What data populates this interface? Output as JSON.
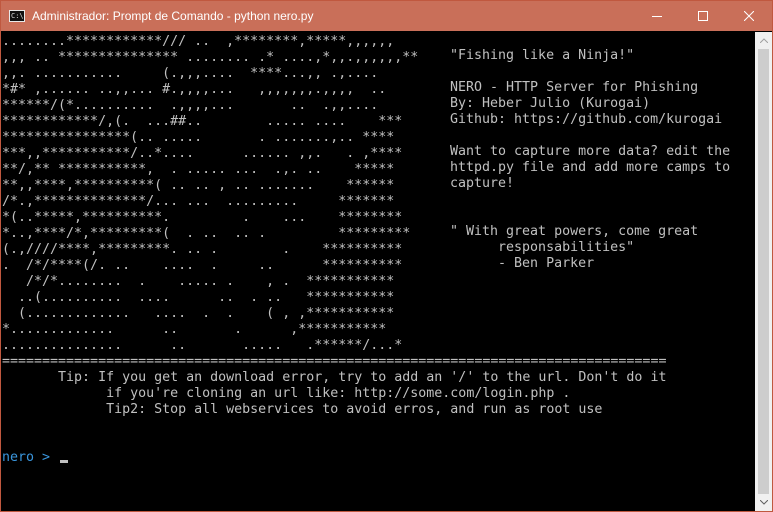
{
  "window": {
    "title": "Administrador: Prompt de Comando - python  nero.py",
    "icon_label": "C:\\"
  },
  "console": {
    "ascii_art": "........************/// ..  ,********,*****,,,,,,\n,,, .. *************** ........ .* ....,*,,.,,,,,,**\n,,. ...........     (.,,,....  ****...,, .,....\n*#* ,...... ..,,... #.,,,,...   ,,,,,,,.,,,,  ..\n******/(*..........  .,,,,...       ..  .,,....\n************/,(.  ...##..        ..... ....    ***\n****************(.. .....       . .......,.. ****\n***,,***********/..*....      ...... ,,.   . ,****\n**/,** ***********,  . ..... ...  .,. ..    *****\n**,,****,**********( .. .. , .. .......    ******\n/*.,**************/... ...  .........     *******\n*(..*****,**********.         .    ...    ********\n*..,****/*,*********(  . ..  .. .         *********\n(.,////****,*********. .. .        .    **********\n.  /*/****(/. ..    ....  .     ..      **********\n   /*/*........  .    ..... .    , .  ***********\n  ..(..........  ....      ..  . ..   ***********\n  (.............   ....  .  .    ( , ,***********\n*.............      ..       .      ,***********\n...............      ..       .....   .******/...*",
    "info_text": "\"Fishing like a Ninja!\"\n\nNERO - HTTP Server for Phishing\nBy: Heber Julio (Kurogai)\nGithub: https://github.com/kurogai\n\nWant to capture more data? edit the\nhttpd.py file and add more camps to\ncapture!\n\n\n\" With great powers, come great\n      responsabilities\"\n      - Ben Parker",
    "separator": "===============================================================================================",
    "tips_text": "       Tip: If you get an download error, try to add an '/' to the url. Don't do it\n             if you're cloning an url like: http://some.com/login.php .\n             Tip2: Stop all webservices to avoid erros, and run as root use",
    "prompt": "nero > "
  },
  "colors": {
    "titlebar": "#c96f59",
    "console_bg": "#000000",
    "console_text": "#c0c0c0",
    "prompt": "#3a96dd"
  }
}
